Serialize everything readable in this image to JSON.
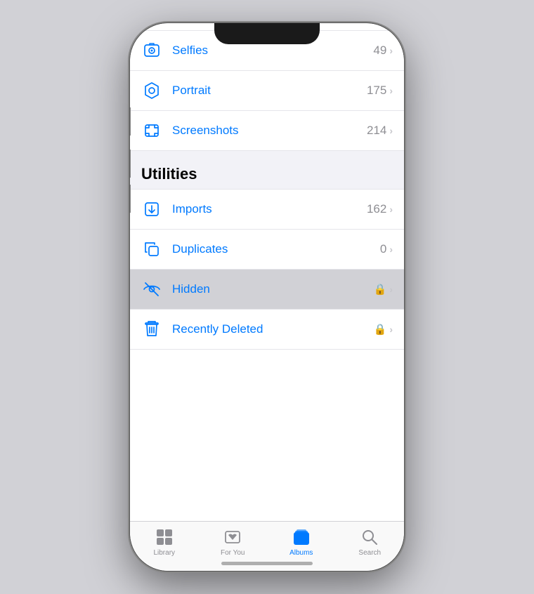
{
  "phone": {
    "screen_bg": "#ffffff"
  },
  "list": {
    "items_top": [
      {
        "id": "selfies",
        "label": "Selfies",
        "count": "49",
        "icon": "selfies",
        "highlighted": false
      },
      {
        "id": "portrait",
        "label": "Portrait",
        "count": "175",
        "icon": "portrait",
        "highlighted": false
      },
      {
        "id": "screenshots",
        "label": "Screenshots",
        "count": "214",
        "icon": "screenshots",
        "highlighted": false
      }
    ],
    "section_title": "Utilities",
    "items_utilities": [
      {
        "id": "imports",
        "label": "Imports",
        "count": "162",
        "icon": "imports",
        "highlighted": false,
        "lock": false
      },
      {
        "id": "duplicates",
        "label": "Duplicates",
        "count": "0",
        "icon": "duplicates",
        "highlighted": false,
        "lock": false
      },
      {
        "id": "hidden",
        "label": "Hidden",
        "count": "",
        "icon": "hidden",
        "highlighted": true,
        "lock": true
      },
      {
        "id": "recently-deleted",
        "label": "Recently Deleted",
        "count": "",
        "icon": "recently-deleted",
        "highlighted": false,
        "lock": true
      }
    ]
  },
  "tabs": [
    {
      "id": "library",
      "label": "Library",
      "active": false
    },
    {
      "id": "for-you",
      "label": "For You",
      "active": false
    },
    {
      "id": "albums",
      "label": "Albums",
      "active": true
    },
    {
      "id": "search",
      "label": "Search",
      "active": false
    }
  ]
}
